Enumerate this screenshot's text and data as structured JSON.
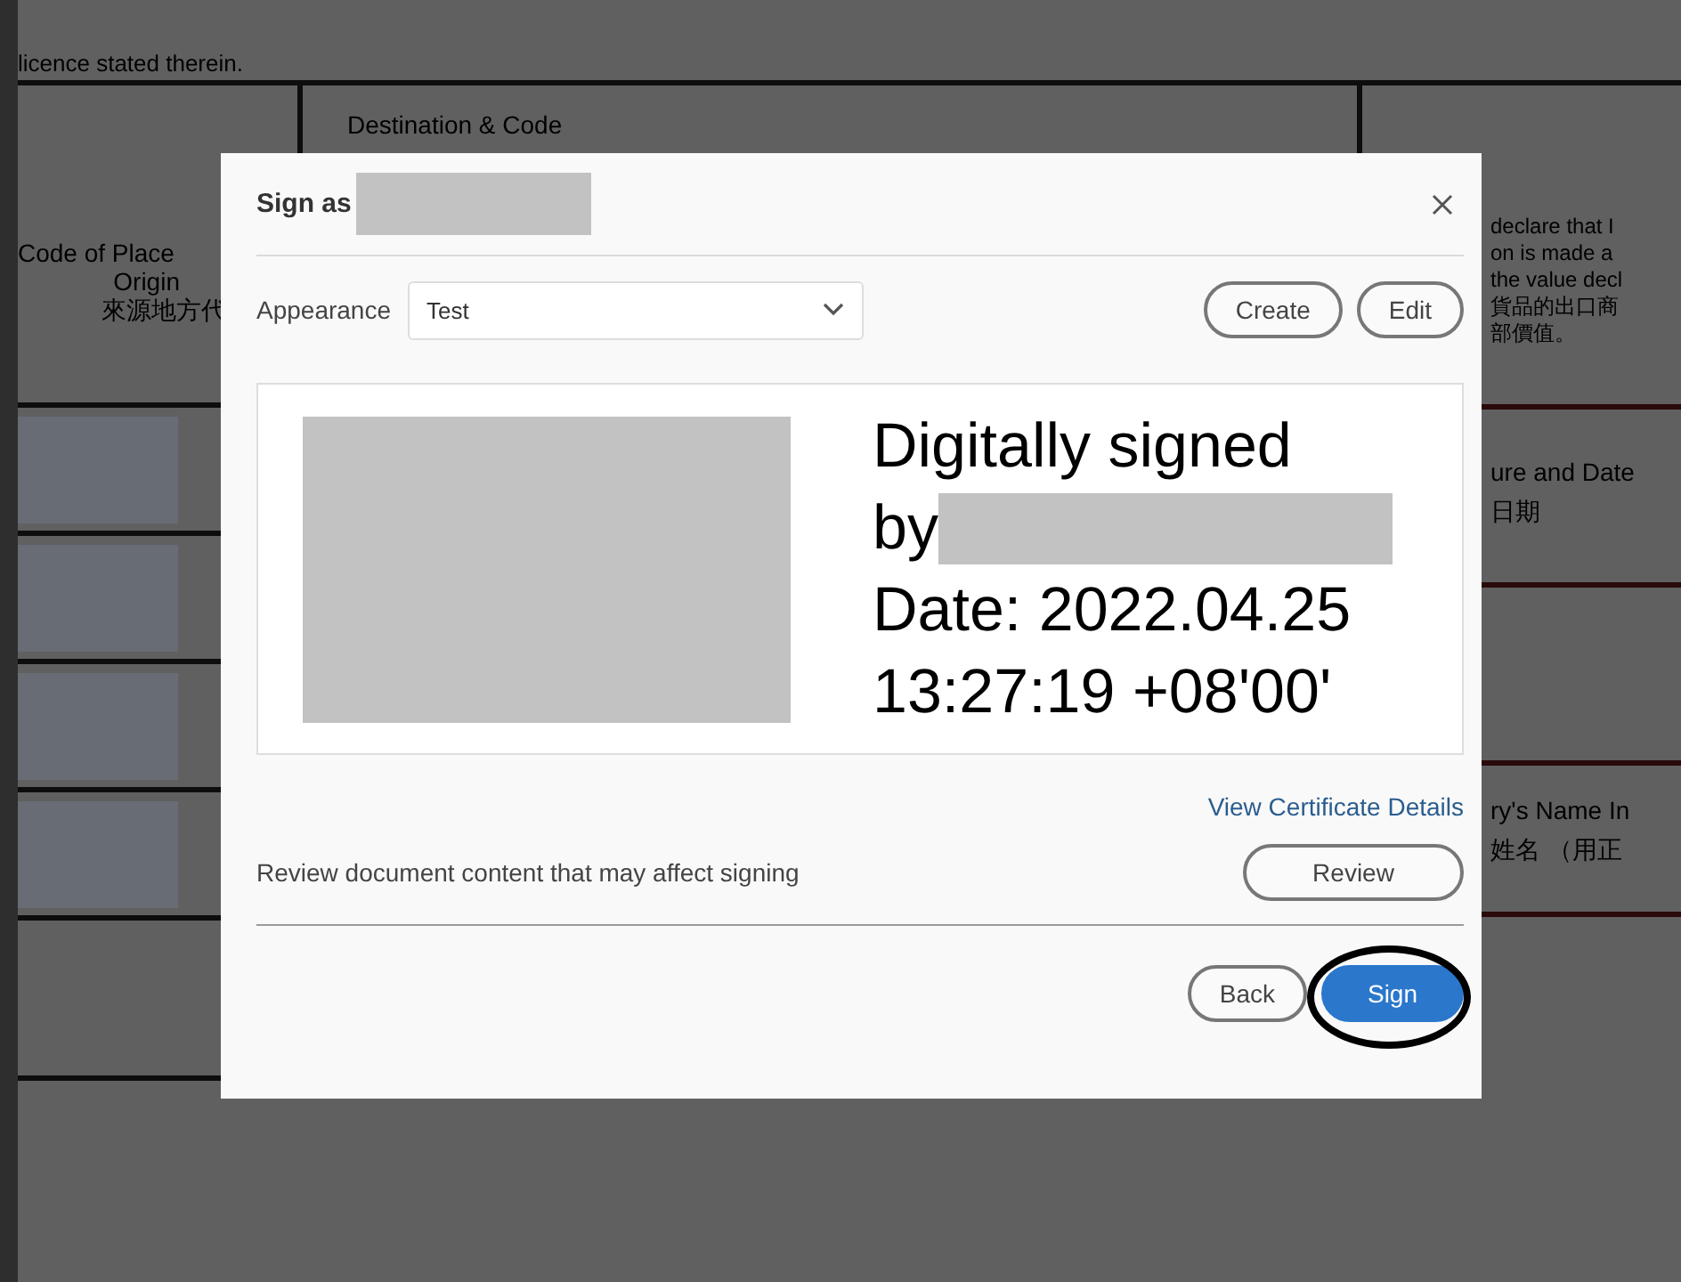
{
  "document": {
    "intro": "licence stated therein.",
    "heading": "Destination & Code",
    "left_lines": [
      "Code of Place",
      "Origin",
      "來源地方代"
    ],
    "right_lines": [
      "declare that I",
      "on is made a",
      "the value decl",
      "貨品的出口商",
      "部價值。"
    ],
    "right_sections": [
      [
        "ure and Date",
        "日期"
      ],
      [
        "ry's Name In",
        "姓名 （用正"
      ]
    ]
  },
  "dialog": {
    "title": "Sign as",
    "appearance_label": "Appearance",
    "appearance_value": "Test",
    "top_buttons": [
      "Create",
      "Edit"
    ],
    "preview_lines": [
      "Digitally signed",
      "by",
      "Date: 2022.04.25",
      "13:27:19 +08'00'"
    ],
    "certificate_link": "View Certificate Details",
    "review_text": "Review document content that may affect signing",
    "review_button": "Review",
    "footer_buttons": [
      {
        "label": "Back",
        "kind": "secondary",
        "highlighted": false
      },
      {
        "label": "Sign",
        "kind": "primary",
        "highlighted": true
      }
    ]
  }
}
